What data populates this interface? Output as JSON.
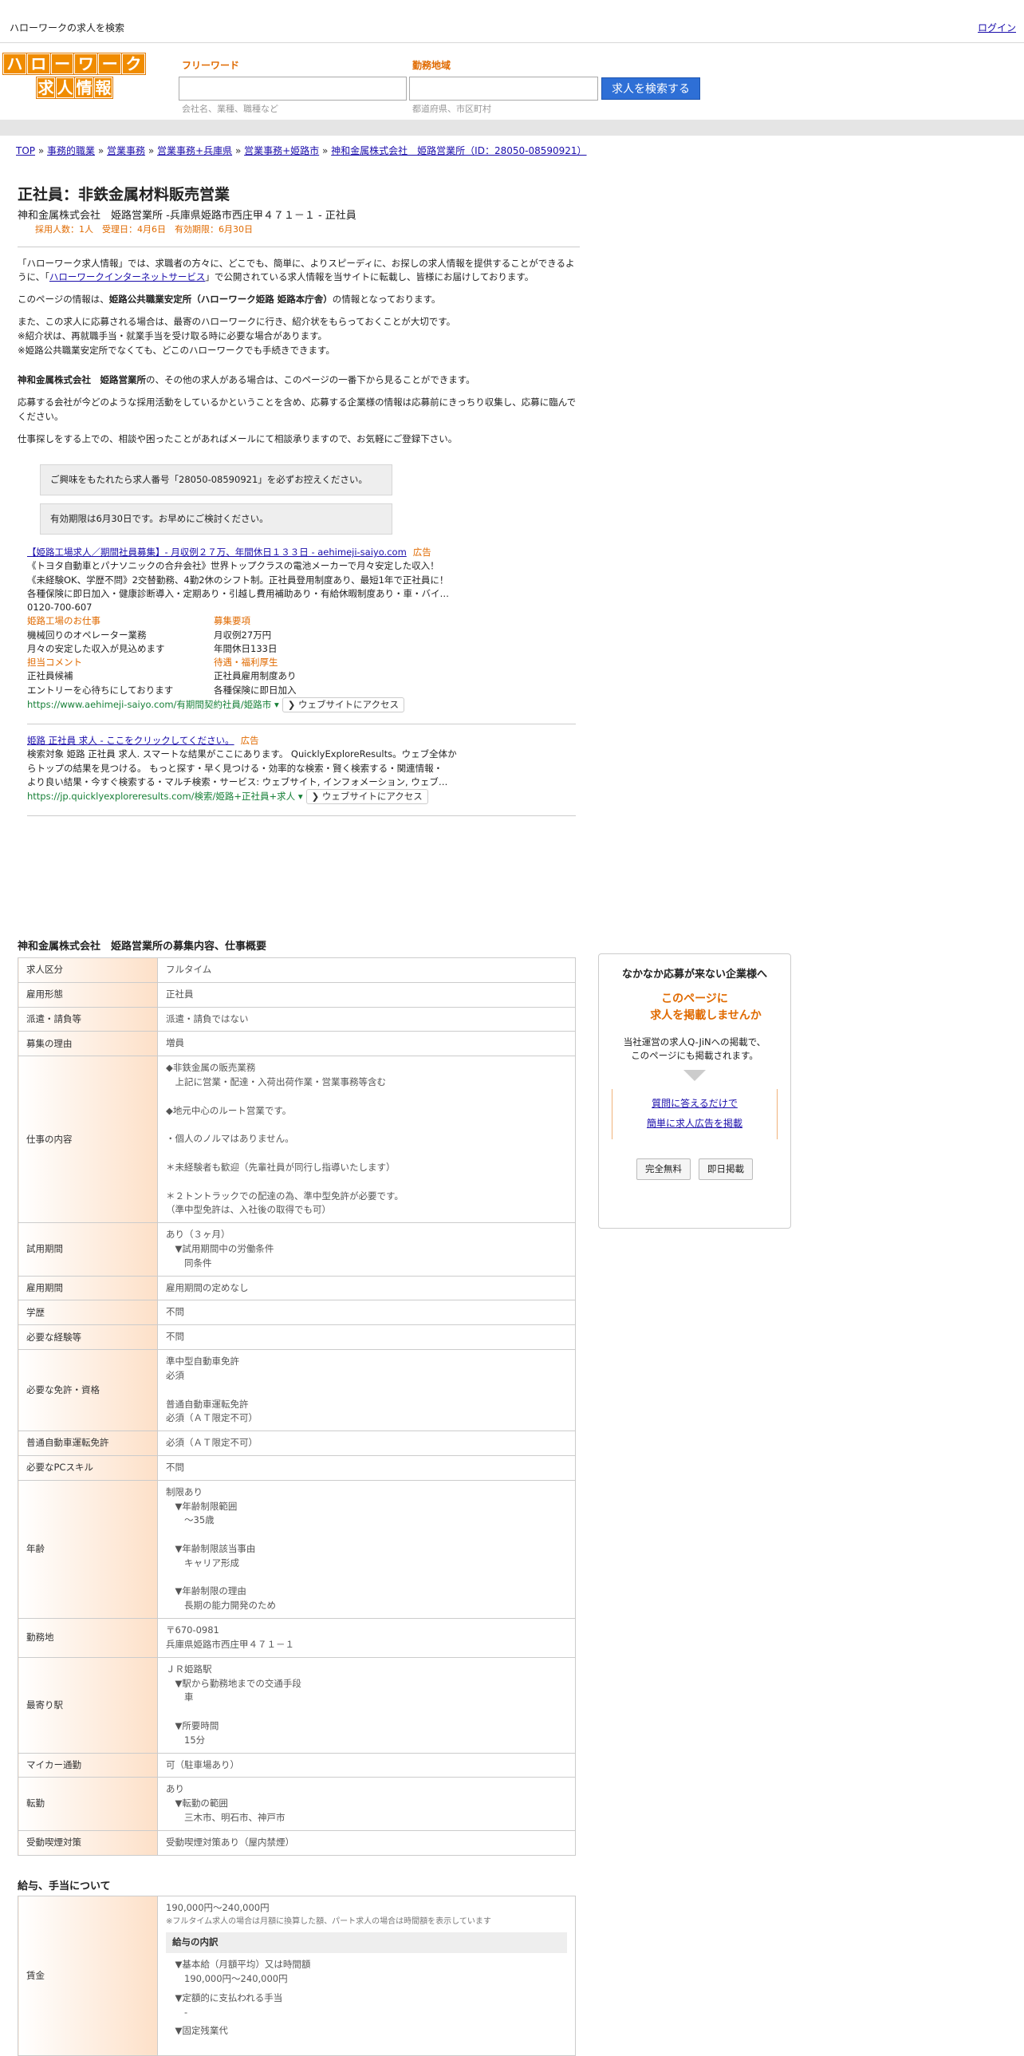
{
  "header": {
    "site_title": "ハローワークの求人を検索",
    "login": "ログイン"
  },
  "logo": {
    "row1": [
      "ハ",
      "ロ",
      "ー",
      "ワ",
      "ー",
      "ク"
    ],
    "row2": [
      "求",
      "人",
      "情",
      "報"
    ]
  },
  "search": {
    "keyword_label": "フリーワード",
    "keyword_hint": "会社名、業種、職種など",
    "area_label": "勤務地域",
    "area_hint": "都道府県、市区町村",
    "button": "求人を検索する"
  },
  "breadcrumb": [
    "TOP",
    "事務的職業",
    "営業事務",
    "営業事務+兵庫県",
    "営業事務+姫路市",
    "神和金属株式会社　姫路営業所（ID：28050-08590921）"
  ],
  "breadcrumb_sep": "»",
  "job": {
    "title": "正社員：非鉄金属材料販売営業",
    "company_line": "神和金属株式会社　姫路営業所 -兵庫県姫路市西庄甲４７１－１ - 正社員",
    "meta": "採用人数：1人　受理日：4月6日　有効期限：6月30日"
  },
  "intro": {
    "p1_a": "「ハローワーク求人情報」では、求職者の方々に、どこでも、簡単に、よりスピーディに、お探しの求人情報を提供することができるように、「",
    "p1_link": "ハローワークインターネットサービス",
    "p1_b": "」で公開されている求人情報を当サイトに転載し、皆様にお届けしております。",
    "p2_a": "このページの情報は、",
    "p2_bold": "姫路公共職業安定所（ハローワーク姫路 姫路本庁舎）",
    "p2_b": "の情報となっております。",
    "p3_l1": "また、この求人に応募される場合は、最寄のハローワークに行き、紹介状をもらっておくことが大切です。",
    "p3_l2": "※紹介状は、再就職手当・就業手当を受け取る時に必要な場合があります。",
    "p3_l3": "※姫路公共職業安定所でなくても、どこのハローワークでも手続きできます。",
    "p4_bold": "神和金属株式会社　姫路営業所",
    "p4_b": "の、その他の求人がある場合は、このページの一番下から見ることができます。",
    "p5": "応募する会社が今どのような採用活動をしているかということを含め、応募する企業様の情報は応募前にきっちり収集し、応募に臨んでください。",
    "p6": "仕事探しをする上での、相談や困ったことがあればメールにて相談承りますので、お気軽にご登録下さい。",
    "box1": "ご興味をもたれたら求人番号「28050-08590921」を必ずお控えください。",
    "box2": "有効期限は6月30日です。お早めにご検討ください。"
  },
  "ads": [
    {
      "title": "【姫路工場求人／期間社員募集】- 月収例２７万、年間休日１３３日 - aehimeji-saiyo.com",
      "tag": "広告",
      "desc1": "《トヨタ自動車とパナソニックの合弁会社》世界トップクラスの電池メーカーで月々安定した収入！",
      "desc2": "《未経験OK、学歴不問》2交替勤務、4勤2休のシフト制。正社員登用制度あり、最短1年で正社員に！",
      "desc3": "各種保険に即日加入・健康診断導入・定期あり・引越し費用補助あり・有給休暇制度あり・車・バイ…",
      "phone": "0120-700-607",
      "col1_label1": "姫路工場のお仕事",
      "col1_text1a": "機械回りのオペレーター業務",
      "col1_text1b": "月々の安定した収入が見込めます",
      "col2_label1": "募集要項",
      "col2_text1a": "月収例27万円",
      "col2_text1b": "年間休日133日",
      "col1_label2": "担当コメント",
      "col1_text2a": "正社員候補",
      "col1_text2b": "エントリーを心待ちにしております",
      "col2_label2": "待遇・福利厚生",
      "col2_text2a": "正社員雇用制度あり",
      "col2_text2b": "各種保険に即日加入",
      "url": "https://www.aehimeji-saiyo.com/有期間契約社員/姫路市 ▾",
      "visit": "❯ ウェブサイトにアクセス"
    },
    {
      "title": "姫路 正社員 求人 - ここをクリックしてください。",
      "tag": "広告",
      "desc1": "検索対象 姫路 正社員 求人. スマートな結果がここにあります。 QuicklyExploreResults。ウェブ全体か",
      "desc2": "らトップの結果を見つける。 もっと探す・早く見つける・効率的な検索・賢く検索する・関連情報・",
      "desc3": "より良い結果・今すぐ検索する・マルチ検索・サービス: ウェブサイト, インフォメーション, ウェブ…",
      "url": "https://jp.quicklyexploreresults.com/検索/姫路+正社員+求人 ▾",
      "visit": "❯ ウェブサイトにアクセス"
    }
  ],
  "details": {
    "section_title": "神和金属株式会社　姫路営業所の募集内容、仕事概要",
    "rows": [
      {
        "label": "求人区分",
        "value": "フルタイム"
      },
      {
        "label": "雇用形態",
        "value": "正社員"
      },
      {
        "label": "派遣・請負等",
        "value": "派遣・請負ではない"
      },
      {
        "label": "募集の理由",
        "value": "増員"
      },
      {
        "label": "仕事の内容",
        "value": "◆非鉄金属の販売業務\n　上記に営業・配達・入荷出荷作業・営業事務等含む\n\n◆地元中心のルート営業です。\n\n・個人のノルマはありません。\n\n＊未経験者も歓迎（先輩社員が同行し指導いたします）\n\n＊２トントラックでの配達の為、準中型免許が必要です。\n（準中型免許は、入社後の取得でも可）"
      },
      {
        "label": "試用期間",
        "value": "あり（３ヶ月）\n　▼試用期間中の労働条件\n　　同条件"
      },
      {
        "label": "雇用期間",
        "value": "雇用期間の定めなし"
      },
      {
        "label": "学歴",
        "value": "不問"
      },
      {
        "label": "必要な経験等",
        "value": "不問"
      },
      {
        "label": "必要な免許・資格",
        "value": "準中型自動車免許\n必須\n\n普通自動車運転免許\n必須（ＡＴ限定不可）"
      },
      {
        "label": "普通自動車運転免許",
        "value": "必須（ＡＴ限定不可）"
      },
      {
        "label": "必要なPCスキル",
        "value": "不問"
      },
      {
        "label": "年齢",
        "value": "制限あり\n　▼年齢制限範囲\n　　〜35歳\n\n　▼年齢制限該当事由\n　　キャリア形成\n\n　▼年齢制限の理由\n　　長期の能力開発のため"
      },
      {
        "label": "勤務地",
        "value": "〒670-0981\n兵庫県姫路市西庄甲４７１－１"
      },
      {
        "label": "最寄り駅",
        "value": "ＪＲ姫路駅\n　▼駅から勤務地までの交通手段\n　　車\n\n　▼所要時間\n　　15分"
      },
      {
        "label": "マイカー通勤",
        "value": "可（駐車場あり）"
      },
      {
        "label": "転勤",
        "value": "あり\n　▼転勤の範囲\n　　三木市、明石市、神戸市"
      },
      {
        "label": "受動喫煙対策",
        "value": "受動喫煙対策あり（屋内禁煙）"
      }
    ]
  },
  "salary": {
    "section_title": "給与、手当について",
    "label": "賃金",
    "range": "190,000円〜240,000円",
    "note": "※フルタイム求人の場合は月額に換算した額、パート求人の場合は時間額を表示しています",
    "breakdown_title": "給与の内訳",
    "b1": "　▼基本給（月額平均）又は時間額",
    "b1v": "　　190,000円〜240,000円",
    "b2": "　▼定額的に支払われる手当",
    "b2v": "　　-",
    "b3": "　▼固定残業代"
  },
  "sidebar": {
    "heading": "なかなか応募が来ない企業様へ",
    "emph1": "このページに",
    "emph2": "求人を掲載しませんか",
    "p1": "当社運営の求人Q-JiNへの掲載で、",
    "p2": "このページにも掲載されます。",
    "link1": "質問に答えるだけで",
    "link2": "簡単に求人広告を掲載",
    "btn1": "完全無料",
    "btn2": "即日掲載"
  },
  "colors": {
    "accent": "#f08c00",
    "label_orange": "#e06a00",
    "link": "#1a0dab",
    "button": "#2e6fd6"
  }
}
